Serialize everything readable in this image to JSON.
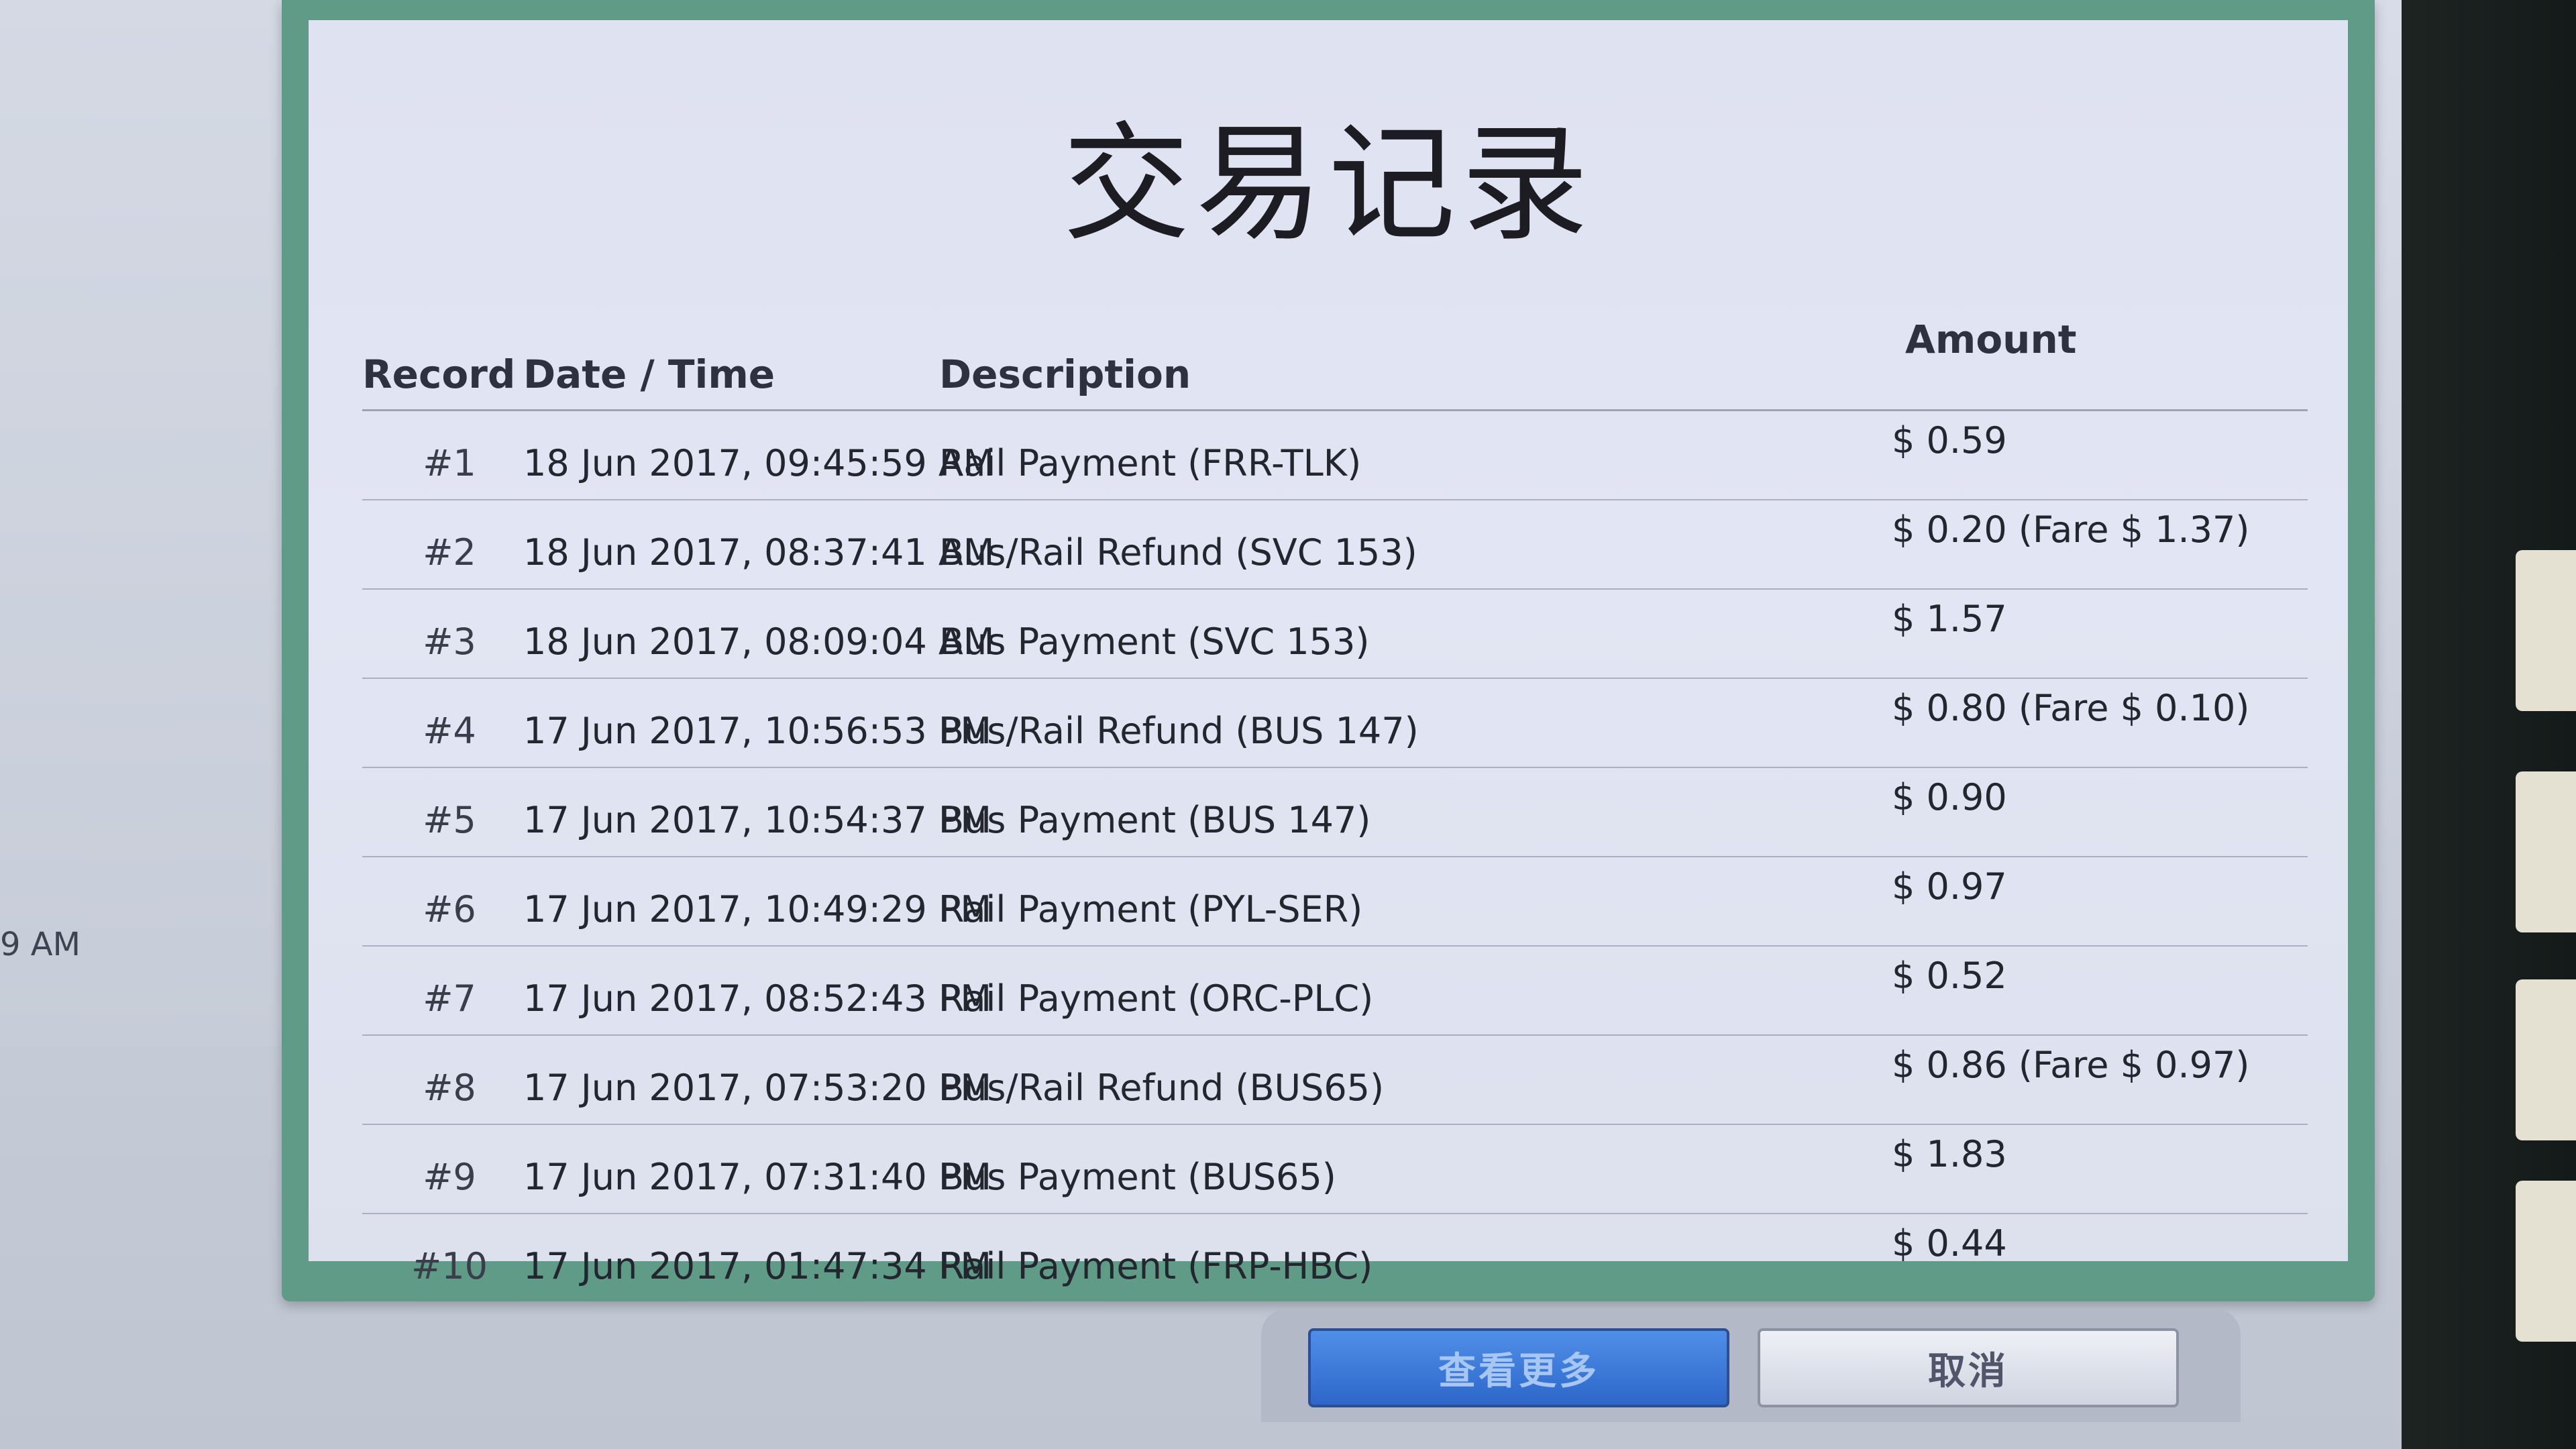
{
  "dialog": {
    "title": "交易记录"
  },
  "background": {
    "fragment_text": "9 AM"
  },
  "table": {
    "headers": {
      "record": "Record",
      "datetime": "Date / Time",
      "description": "Description",
      "amount": "Amount"
    },
    "rows": [
      {
        "record": "#1",
        "datetime": "18 Jun 2017, 09:45:59 AM",
        "description": "Rail Payment (FRR-TLK)",
        "amount": "$ 0.59"
      },
      {
        "record": "#2",
        "datetime": "18 Jun 2017, 08:37:41 AM",
        "description": "Bus/Rail Refund (SVC 153)",
        "amount": "$ 0.20 (Fare $ 1.37)"
      },
      {
        "record": "#3",
        "datetime": "18 Jun 2017, 08:09:04 AM",
        "description": "Bus Payment (SVC 153)",
        "amount": "$ 1.57"
      },
      {
        "record": "#4",
        "datetime": "17 Jun 2017, 10:56:53 PM",
        "description": "Bus/Rail Refund (BUS 147)",
        "amount": "$ 0.80 (Fare $ 0.10)"
      },
      {
        "record": "#5",
        "datetime": "17 Jun 2017, 10:54:37 PM",
        "description": "Bus Payment (BUS 147)",
        "amount": "$ 0.90"
      },
      {
        "record": "#6",
        "datetime": "17 Jun 2017, 10:49:29 PM",
        "description": "Rail Payment (PYL-SER)",
        "amount": "$ 0.97"
      },
      {
        "record": "#7",
        "datetime": "17 Jun 2017, 08:52:43 PM",
        "description": "Rail Payment (ORC-PLC)",
        "amount": "$ 0.52"
      },
      {
        "record": "#8",
        "datetime": "17 Jun 2017, 07:53:20 PM",
        "description": "Bus/Rail Refund (BUS65)",
        "amount": "$ 0.86 (Fare $ 0.97)"
      },
      {
        "record": "#9",
        "datetime": "17 Jun 2017, 07:31:40 PM",
        "description": "Bus Payment (BUS65)",
        "amount": "$ 1.83"
      },
      {
        "record": "#10",
        "datetime": "17 Jun 2017, 01:47:34 PM",
        "description": "Rail Payment (FRP-HBC)",
        "amount": "$ 0.44"
      }
    ]
  },
  "buttons": {
    "more_label": "查看更多",
    "cancel_label": "取消"
  },
  "colors": {
    "dialog_frame": "#5f9b86",
    "more_button": "#2d67c9",
    "bezel": "#141a19"
  }
}
